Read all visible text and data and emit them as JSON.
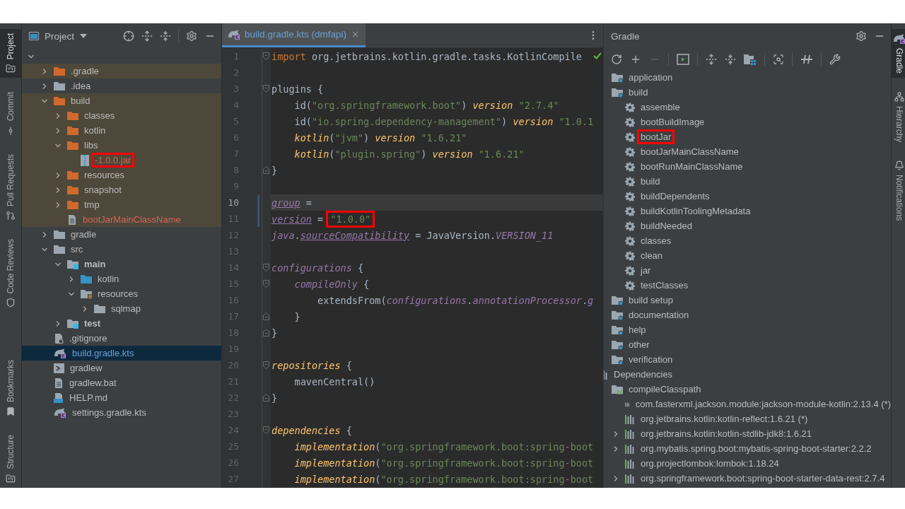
{
  "left_toolbar": {
    "top": [
      {
        "label": "Project",
        "kind": "project",
        "selected": true
      },
      {
        "label": "Commit",
        "kind": "commit",
        "selected": false
      },
      {
        "label": "Pull Requests",
        "kind": "pull",
        "selected": false
      },
      {
        "label": "Code Reviews",
        "kind": "review",
        "selected": false
      }
    ],
    "bottom": [
      {
        "label": "Bookmarks",
        "kind": "bookmark",
        "selected": false
      },
      {
        "label": "Structure",
        "kind": "structure",
        "selected": false
      }
    ]
  },
  "project_panel": {
    "title": "Project",
    "root_expanded": true,
    "items": [
      {
        "label": ".gradle",
        "kind": "excluded",
        "expanded": false,
        "excluded": true,
        "selected": false,
        "unversioned": false,
        "modified": false,
        "marked": false
      },
      {
        "label": ".idea",
        "kind": "folder",
        "expanded": false,
        "excluded": false,
        "selected": false,
        "unversioned": false,
        "modified": false,
        "marked": false
      },
      {
        "label": "build",
        "kind": "excluded",
        "expanded": true,
        "excluded": true,
        "selected": false,
        "unversioned": false,
        "modified": false,
        "marked": false,
        "children": [
          {
            "label": "classes",
            "kind": "excluded",
            "expanded": false,
            "excluded": true,
            "selected": false,
            "unversioned": false,
            "modified": false,
            "marked": false
          },
          {
            "label": "kotlin",
            "kind": "excluded",
            "expanded": false,
            "excluded": true,
            "selected": false,
            "unversioned": false,
            "modified": false,
            "marked": false
          },
          {
            "label": "libs",
            "kind": "excluded",
            "expanded": true,
            "excluded": true,
            "selected": false,
            "unversioned": false,
            "modified": false,
            "marked": false,
            "children": [
              {
                "label": "-1.0.0.jar",
                "kind": "jar",
                "excluded": true,
                "selected": false,
                "unversioned": true,
                "modified": false,
                "marked": true
              }
            ]
          },
          {
            "label": "resources",
            "kind": "excluded",
            "expanded": false,
            "excluded": true,
            "selected": false,
            "unversioned": false,
            "modified": false,
            "marked": false
          },
          {
            "label": "snapshot",
            "kind": "excluded",
            "expanded": false,
            "excluded": true,
            "selected": false,
            "unversioned": false,
            "modified": false,
            "marked": false
          },
          {
            "label": "tmp",
            "kind": "excluded",
            "expanded": false,
            "excluded": true,
            "selected": false,
            "unversioned": false,
            "modified": false,
            "marked": false
          },
          {
            "label": "bootJarMainClassName",
            "kind": "textfile",
            "excluded": true,
            "selected": false,
            "unversioned": true,
            "modified": false,
            "marked": false
          }
        ]
      },
      {
        "label": "gradle",
        "kind": "folder",
        "expanded": false,
        "excluded": false,
        "selected": false,
        "unversioned": false,
        "modified": false,
        "marked": false
      },
      {
        "label": "src",
        "kind": "folder",
        "expanded": true,
        "excluded": false,
        "selected": false,
        "unversioned": false,
        "modified": false,
        "marked": false,
        "children": [
          {
            "label": "main",
            "kind": "root",
            "expanded": true,
            "excluded": false,
            "selected": false,
            "unversioned": false,
            "modified": false,
            "marked": false,
            "children": [
              {
                "label": "kotlin",
                "kind": "source",
                "expanded": false,
                "excluded": false,
                "selected": false,
                "unversioned": false,
                "modified": false,
                "marked": false
              },
              {
                "label": "resources",
                "kind": "resources",
                "expanded": true,
                "excluded": false,
                "selected": false,
                "unversioned": false,
                "modified": false,
                "marked": false,
                "children": [
                  {
                    "label": "sqlmap",
                    "kind": "folder",
                    "expanded": false,
                    "excluded": false,
                    "selected": false,
                    "unversioned": false,
                    "modified": false,
                    "marked": false
                  }
                ]
              }
            ]
          },
          {
            "label": "test",
            "kind": "root",
            "expanded": false,
            "excluded": false,
            "selected": false,
            "unversioned": false,
            "modified": false,
            "marked": false
          }
        ]
      },
      {
        "label": ".gitignore",
        "kind": "ignore",
        "excluded": false,
        "selected": false,
        "unversioned": false,
        "modified": false,
        "marked": false
      },
      {
        "label": "build.gradle.kts",
        "kind": "gradle",
        "excluded": false,
        "selected": true,
        "unversioned": false,
        "modified": true,
        "marked": false
      },
      {
        "label": "gradlew",
        "kind": "script",
        "excluded": false,
        "selected": false,
        "unversioned": false,
        "modified": false,
        "marked": false
      },
      {
        "label": "gradlew.bat",
        "kind": "textfile",
        "excluded": false,
        "selected": false,
        "unversioned": false,
        "modified": false,
        "marked": false
      },
      {
        "label": "HELP.md",
        "kind": "markdown",
        "excluded": false,
        "selected": false,
        "unversioned": false,
        "modified": false,
        "marked": false
      },
      {
        "label": "settings.gradle.kts",
        "kind": "gradle",
        "excluded": false,
        "selected": false,
        "unversioned": false,
        "modified": false,
        "marked": false
      }
    ]
  },
  "editor": {
    "tabs": [
      {
        "label": "build.gradle.kts (dmfapi)",
        "selected": true
      }
    ],
    "lines": [
      {
        "number": "1",
        "current": false,
        "modified": false,
        "fold_start": true,
        "fold_end": false,
        "tokens": [
          {
            "kind": "kw",
            "t": "import"
          },
          {
            "kind": "plain",
            "t": " org.jetbrains.kotlin.gradle.tasks.KotlinCompile"
          }
        ]
      },
      {
        "number": "2",
        "current": false,
        "modified": false,
        "fold_start": false,
        "fold_end": false
      },
      {
        "number": "3",
        "current": false,
        "modified": false,
        "fold_start": true,
        "fold_end": false,
        "tokens": [
          {
            "kind": "plain",
            "t": "plugins {"
          }
        ]
      },
      {
        "number": "4",
        "current": false,
        "modified": false,
        "fold_start": false,
        "fold_end": false,
        "tokens": [
          {
            "kind": "plain",
            "t": "    id("
          },
          {
            "kind": "str",
            "t": "\"org.springframework.boot\""
          },
          {
            "kind": "plain",
            "t": ")"
          },
          {
            "kind": "fn",
            "t": " version"
          },
          {
            "kind": "str",
            "t": " \"2.7.4\""
          }
        ]
      },
      {
        "number": "5",
        "current": false,
        "modified": false,
        "fold_start": false,
        "fold_end": false,
        "tokens": [
          {
            "kind": "plain",
            "t": "    id("
          },
          {
            "kind": "str",
            "t": "\"io.spring.dependency-management\""
          },
          {
            "kind": "plain",
            "t": ")"
          },
          {
            "kind": "fn",
            "t": " version"
          },
          {
            "kind": "str",
            "t": " \"1.0.1"
          }
        ]
      },
      {
        "number": "6",
        "current": false,
        "modified": false,
        "fold_start": false,
        "fold_end": false,
        "tokens": [
          {
            "kind": "fn",
            "t": "    kotlin"
          },
          {
            "kind": "plain",
            "t": "("
          },
          {
            "kind": "str",
            "t": "\"jvm\""
          },
          {
            "kind": "plain",
            "t": ")"
          },
          {
            "kind": "fn",
            "t": " version"
          },
          {
            "kind": "str",
            "t": " \"1.6.21\""
          }
        ]
      },
      {
        "number": "7",
        "current": false,
        "modified": false,
        "fold_start": false,
        "fold_end": false,
        "tokens": [
          {
            "kind": "fn",
            "t": "    kotlin"
          },
          {
            "kind": "plain",
            "t": "("
          },
          {
            "kind": "str",
            "t": "\"plugin.spring\""
          },
          {
            "kind": "plain",
            "t": ")"
          },
          {
            "kind": "fn",
            "t": " version"
          },
          {
            "kind": "str",
            "t": " \"1.6.21\""
          }
        ]
      },
      {
        "number": "8",
        "current": false,
        "modified": false,
        "fold_start": false,
        "fold_end": true,
        "tokens": [
          {
            "kind": "plain",
            "t": "}"
          }
        ]
      },
      {
        "number": "9",
        "current": false,
        "modified": false,
        "fold_start": false,
        "fold_end": false
      },
      {
        "number": "10",
        "current": true,
        "modified": true,
        "fold_start": false,
        "fold_end": false,
        "tokens": [
          {
            "kind": "prop",
            "t": "group"
          },
          {
            "kind": "plain",
            "t": " ="
          }
        ]
      },
      {
        "number": "11",
        "current": false,
        "modified": true,
        "fold_start": false,
        "fold_end": false,
        "tokens": [
          {
            "kind": "prop",
            "t": "version"
          },
          {
            "kind": "plain",
            "t": " ="
          },
          {
            "kind": "boxed",
            "t": "\"1.0.0\""
          }
        ]
      },
      {
        "number": "12",
        "current": false,
        "modified": false,
        "fold_start": false,
        "fold_end": false,
        "tokens": [
          {
            "kind": "pv",
            "t": "java"
          },
          {
            "kind": "plain",
            "t": "."
          },
          {
            "kind": "prop",
            "t": "sourceCompatibility"
          },
          {
            "kind": "plain",
            "t": " = JavaVersion."
          },
          {
            "kind": "pv",
            "t": "VERSION_11"
          }
        ]
      },
      {
        "number": "13",
        "current": false,
        "modified": false,
        "fold_start": false,
        "fold_end": false
      },
      {
        "number": "14",
        "current": false,
        "modified": false,
        "fold_start": true,
        "fold_end": false,
        "tokens": [
          {
            "kind": "pv",
            "t": "configurations"
          },
          {
            "kind": "plain",
            "t": " {"
          }
        ]
      },
      {
        "number": "15",
        "current": false,
        "modified": false,
        "fold_start": true,
        "fold_end": false,
        "tokens": [
          {
            "kind": "pv",
            "t": "    compileOnly"
          },
          {
            "kind": "plain",
            "t": " {"
          }
        ]
      },
      {
        "number": "16",
        "current": false,
        "modified": false,
        "fold_start": false,
        "fold_end": false,
        "tokens": [
          {
            "kind": "plain",
            "t": "        extendsFrom("
          },
          {
            "kind": "pv",
            "t": "configurations"
          },
          {
            "kind": "plain",
            "t": "."
          },
          {
            "kind": "pv",
            "t": "annotationProcessor"
          },
          {
            "kind": "plain",
            "t": "."
          },
          {
            "kind": "pv",
            "t": "g"
          }
        ]
      },
      {
        "number": "17",
        "current": false,
        "modified": false,
        "fold_start": false,
        "fold_end": true,
        "tokens": [
          {
            "kind": "plain",
            "t": "    }"
          }
        ]
      },
      {
        "number": "18",
        "current": false,
        "modified": false,
        "fold_start": false,
        "fold_end": true,
        "tokens": [
          {
            "kind": "plain",
            "t": "}"
          }
        ]
      },
      {
        "number": "19",
        "current": false,
        "modified": false,
        "fold_start": false,
        "fold_end": false
      },
      {
        "number": "20",
        "current": false,
        "modified": false,
        "fold_start": true,
        "fold_end": false,
        "tokens": [
          {
            "kind": "fn",
            "t": "repositories"
          },
          {
            "kind": "plain",
            "t": " {"
          }
        ]
      },
      {
        "number": "21",
        "current": false,
        "modified": false,
        "fold_start": false,
        "fold_end": false,
        "tokens": [
          {
            "kind": "plain",
            "t": "    mavenCentral()"
          }
        ]
      },
      {
        "number": "22",
        "current": false,
        "modified": false,
        "fold_start": false,
        "fold_end": true,
        "tokens": [
          {
            "kind": "plain",
            "t": "}"
          }
        ]
      },
      {
        "number": "23",
        "current": false,
        "modified": false,
        "fold_start": false,
        "fold_end": false
      },
      {
        "number": "24",
        "current": false,
        "modified": false,
        "fold_start": true,
        "fold_end": false,
        "tokens": [
          {
            "kind": "fn",
            "t": "dependencies"
          },
          {
            "kind": "plain",
            "t": " {"
          }
        ]
      },
      {
        "number": "25",
        "current": false,
        "modified": false,
        "fold_start": false,
        "fold_end": false,
        "tokens": [
          {
            "kind": "fn",
            "t": "    implementation"
          },
          {
            "kind": "plain",
            "t": "("
          },
          {
            "kind": "str",
            "t": "\"org.springframework.boot:spring-boot"
          }
        ]
      },
      {
        "number": "26",
        "current": false,
        "modified": false,
        "fold_start": false,
        "fold_end": false,
        "tokens": [
          {
            "kind": "fn",
            "t": "    implementation"
          },
          {
            "kind": "plain",
            "t": "("
          },
          {
            "kind": "str",
            "t": "\"org.springframework.boot:spring-boot"
          }
        ]
      },
      {
        "number": "27",
        "current": false,
        "modified": false,
        "fold_start": false,
        "fold_end": false,
        "tokens": [
          {
            "kind": "fn",
            "t": "    implementation"
          },
          {
            "kind": "plain",
            "t": "("
          },
          {
            "kind": "str",
            "t": "\"org.springframework.boot:spring-boot"
          }
        ]
      }
    ]
  },
  "gradle_panel": {
    "title": "Gradle",
    "tasks": [
      {
        "label": "application",
        "kind": "group",
        "marked": false
      },
      {
        "label": "build",
        "kind": "group",
        "marked": false,
        "children": [
          {
            "label": "assemble",
            "kind": "task",
            "marked": false
          },
          {
            "label": "bootBuildImage",
            "kind": "task",
            "marked": false
          },
          {
            "label": "bootJar",
            "kind": "task",
            "marked": true
          },
          {
            "label": "bootJarMainClassName",
            "kind": "task",
            "marked": false
          },
          {
            "label": "bootRunMainClassName",
            "kind": "task",
            "marked": false
          },
          {
            "label": "build",
            "kind": "task",
            "marked": false
          },
          {
            "label": "buildDependents",
            "kind": "task",
            "marked": false
          },
          {
            "label": "buildKotlinToolingMetadata",
            "kind": "task",
            "marked": false
          },
          {
            "label": "buildNeeded",
            "kind": "task",
            "marked": false
          },
          {
            "label": "classes",
            "kind": "task",
            "marked": false
          },
          {
            "label": "clean",
            "kind": "task",
            "marked": false
          },
          {
            "label": "jar",
            "kind": "task",
            "marked": false
          },
          {
            "label": "testClasses",
            "kind": "task",
            "marked": false
          }
        ]
      },
      {
        "label": "build setup",
        "kind": "group",
        "marked": false
      },
      {
        "label": "documentation",
        "kind": "group",
        "marked": false
      },
      {
        "label": "help",
        "kind": "group",
        "marked": false
      },
      {
        "label": "other",
        "kind": "group",
        "marked": false
      },
      {
        "label": "verification",
        "kind": "group",
        "marked": false
      }
    ],
    "dependencies": [
      {
        "label": "Dependencies",
        "kind": "dependencies",
        "marked": false,
        "children": [
          {
            "label": "compileClasspath",
            "kind": "configuration",
            "marked": false,
            "children": [
              {
                "label": "com.fasterxml.jackson.module:jackson-module-kotlin:2.13.4 (*)",
                "kind": "dependency",
                "marked": false
              },
              {
                "label": "org.jetbrains.kotlin:kotlin-reflect:1.6.21 (*)",
                "kind": "dependency",
                "marked": false
              },
              {
                "label": "org.jetbrains.kotlin:kotlin-stdlib-jdk8:1.6.21",
                "kind": "dependency",
                "marked": false,
                "expanded": false
              },
              {
                "label": "org.mybatis.spring.boot:mybatis-spring-boot-starter:2.2.2",
                "kind": "dependency",
                "marked": false,
                "expanded": false
              },
              {
                "label": "org.projectlombok:lombok:1.18.24",
                "kind": "dependency",
                "marked": false
              },
              {
                "label": "org.springframework.boot:spring-boot-starter-data-rest:2.7.4",
                "kind": "dependency",
                "marked": false,
                "expanded": false
              }
            ]
          }
        ]
      }
    ]
  },
  "right_toolbar": [
    {
      "label": "Gradle",
      "kind": "gradle",
      "selected": true
    },
    {
      "label": "Hierarchy",
      "kind": "hierarchy",
      "selected": false
    },
    {
      "label": "Notifications",
      "kind": "notifications",
      "selected": false
    }
  ]
}
